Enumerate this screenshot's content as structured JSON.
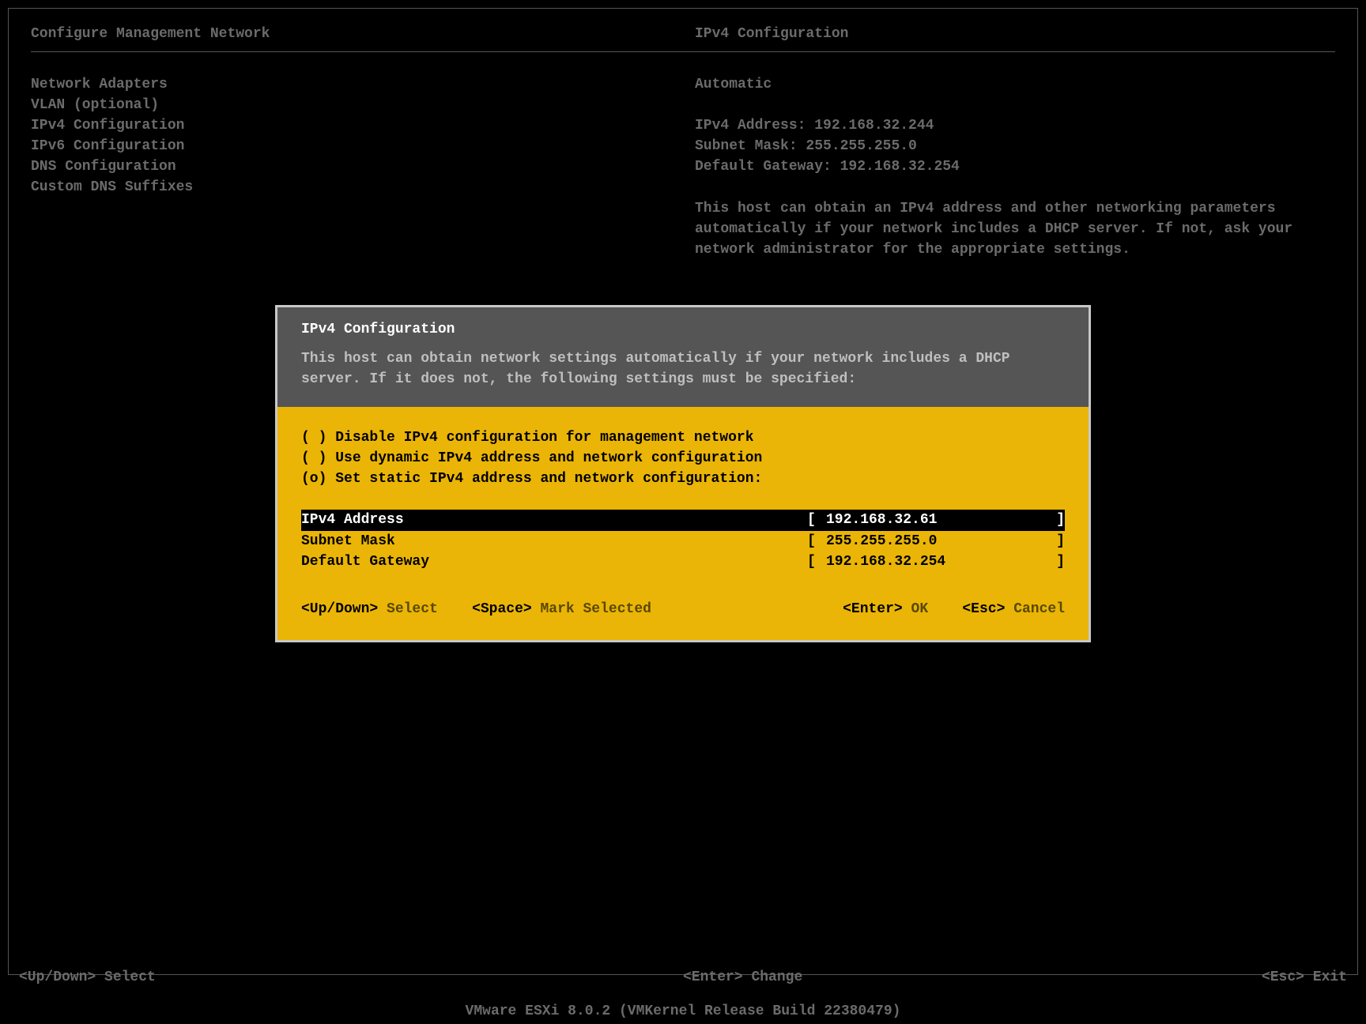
{
  "header": {
    "left_title": "Configure Management Network",
    "right_title": "IPv4 Configuration"
  },
  "left_menu": {
    "items": [
      "Network Adapters",
      "VLAN (optional)",
      "",
      "IPv4 Configuration",
      "IPv6 Configuration",
      "DNS Configuration",
      "Custom DNS Suffixes"
    ]
  },
  "right_info": {
    "automatic": "Automatic",
    "ipv4_label": "IPv4 Address: 192.168.32.244",
    "subnet_label": "Subnet Mask: 255.255.255.0",
    "gateway_label": "Default Gateway: 192.168.32.254",
    "help_text": "This host can obtain an IPv4 address and other networking parameters automatically if your network includes a DHCP server. If not, ask your network administrator for the appropriate settings."
  },
  "dialog": {
    "title": "IPv4 Configuration",
    "description": "This host can obtain network settings automatically if your network includes a DHCP server. If it does not, the following settings must be specified:",
    "radios": [
      {
        "mark": "( )",
        "label": "Disable IPv4 configuration for management network"
      },
      {
        "mark": "( )",
        "label": "Use dynamic IPv4 address and network configuration"
      },
      {
        "mark": "(o)",
        "label": "Set static IPv4 address and network configuration:"
      }
    ],
    "fields": [
      {
        "label": "IPv4 Address",
        "value": "192.168.32.61",
        "selected": true
      },
      {
        "label": "Subnet Mask",
        "value": "255.255.255.0",
        "selected": false
      },
      {
        "label": "Default Gateway",
        "value": "192.168.32.254",
        "selected": false
      }
    ],
    "footer": {
      "updown_key": "<Up/Down>",
      "updown_act": "Select",
      "space_key": "<Space>",
      "space_act": "Mark Selected",
      "enter_key": "<Enter>",
      "enter_act": "OK",
      "esc_key": "<Esc>",
      "esc_act": "Cancel"
    }
  },
  "status_bar": {
    "updown_key": "<Up/Down>",
    "updown_act": "Select",
    "enter_key": "<Enter>",
    "enter_act": "Change",
    "esc_key": "<Esc>",
    "esc_act": "Exit"
  },
  "version": "VMware ESXi 8.0.2 (VMKernel Release Build 22380479)"
}
